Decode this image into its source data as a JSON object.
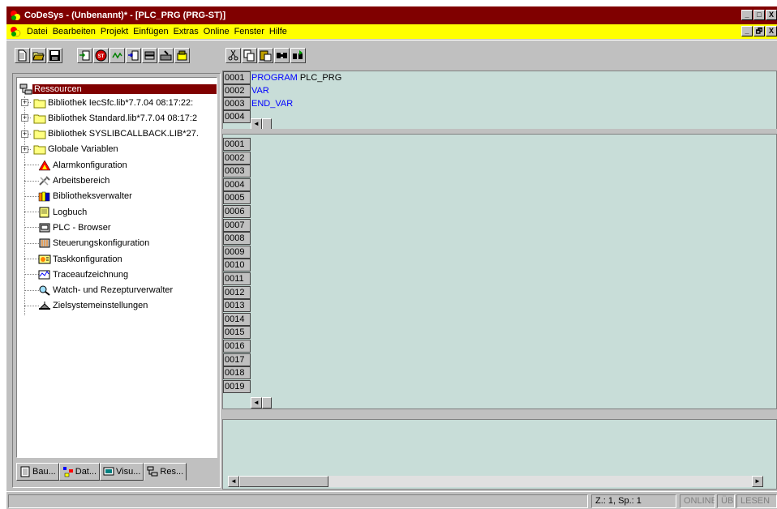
{
  "window": {
    "title": "CoDeSys - (Unbenannt)* - [PLC_PRG (PRG-ST)]",
    "controls": [
      "_",
      "□",
      "X"
    ],
    "mdi_controls": [
      "_",
      "🗗",
      "X"
    ]
  },
  "menubar": {
    "items": [
      "Datei",
      "Bearbeiten",
      "Projekt",
      "Einfügen",
      "Extras",
      "Online",
      "Fenster",
      "Hilfe"
    ]
  },
  "toolbar": {
    "group1": [
      "new-icon",
      "open-icon",
      "save-icon"
    ],
    "group2": [
      "login-icon",
      "stop-icon",
      "run-icon",
      "step-icon",
      "breakpoint-icon",
      "build-icon",
      "force-icon"
    ],
    "group3": [
      "cut-icon",
      "copy-icon",
      "paste-icon",
      "find-icon",
      "replace-icon"
    ]
  },
  "tree": {
    "root": "Ressourcen",
    "items": [
      {
        "label": "Bibliothek IecSfc.lib*7.7.04 08:17:22:",
        "icon": "folder-icon",
        "expandable": true
      },
      {
        "label": "Bibliothek Standard.lib*7.7.04 08:17:2",
        "icon": "folder-icon",
        "expandable": true
      },
      {
        "label": "Bibliothek SYSLIBCALLBACK.LIB*27.",
        "icon": "folder-icon",
        "expandable": true
      },
      {
        "label": "Globale Variablen",
        "icon": "folder-icon",
        "expandable": true
      },
      {
        "label": "Alarmkonfiguration",
        "icon": "alarm-icon",
        "expandable": false
      },
      {
        "label": "Arbeitsbereich",
        "icon": "tools-icon",
        "expandable": false
      },
      {
        "label": "Bibliotheksverwalter",
        "icon": "books-icon",
        "expandable": false
      },
      {
        "label": "Logbuch",
        "icon": "logbook-icon",
        "expandable": false
      },
      {
        "label": "PLC - Browser",
        "icon": "plc-browser-icon",
        "expandable": false
      },
      {
        "label": "Steuerungskonfiguration",
        "icon": "config-icon",
        "expandable": false
      },
      {
        "label": "Taskkonfiguration",
        "icon": "task-icon",
        "expandable": false
      },
      {
        "label": "Traceaufzeichnung",
        "icon": "trace-icon",
        "expandable": false
      },
      {
        "label": "Watch- und Rezepturverwalter",
        "icon": "magnifier-icon",
        "expandable": false
      },
      {
        "label": "Zielsystemeinstellungen",
        "icon": "target-icon",
        "expandable": false
      }
    ],
    "expander_symbol": "+"
  },
  "tabs": [
    {
      "label": "Bau...",
      "icon": "document-icon"
    },
    {
      "label": "Dat...",
      "icon": "datatypes-icon"
    },
    {
      "label": "Visu...",
      "icon": "visualization-icon"
    },
    {
      "label": "Res...",
      "icon": "resources-icon"
    }
  ],
  "declaration": {
    "lines": [
      {
        "num": "0001",
        "kw": "PROGRAM",
        "rest": " PLC_PRG"
      },
      {
        "num": "0002",
        "kw": "VAR",
        "rest": ""
      },
      {
        "num": "0003",
        "kw": "END_VAR",
        "rest": ""
      },
      {
        "num": "0004",
        "kw": "",
        "rest": ""
      }
    ]
  },
  "code": {
    "line_numbers": [
      "0001",
      "0002",
      "0003",
      "0004",
      "0005",
      "0006",
      "0007",
      "0008",
      "0009",
      "0010",
      "0011",
      "0012",
      "0013",
      "0014",
      "0015",
      "0016",
      "0017",
      "0018",
      "0019"
    ]
  },
  "scroll": {
    "left": "◄",
    "right": "►"
  },
  "statusbar": {
    "position": "Z.: 1, Sp.: 1",
    "online": "ONLINE",
    "ub": "ÜB",
    "lesen": "LESEN"
  },
  "colors": {
    "title_bg": "#800000",
    "menu_bg": "#ffff00",
    "editor_bg": "#c8ddd8",
    "keyword": "#0000ff",
    "selection": "#800000"
  }
}
